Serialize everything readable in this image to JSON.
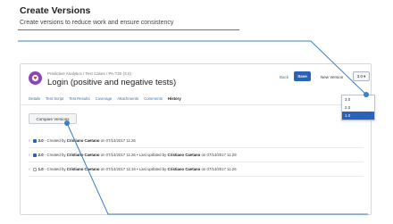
{
  "header": {
    "title": "Create Versions",
    "subtitle": "Create versions to reduce work and ensure consistency"
  },
  "test_case": {
    "breadcrumb": "Predictive Analytics / Test Cases / PA-T20 (3.0)",
    "title": "Login (positive and negative tests)"
  },
  "toolbar": {
    "back_label": "Back",
    "save_label": "Save",
    "new_version_label": "New Version",
    "version_selected": "3.0",
    "version_options": [
      "3.0",
      "2.0",
      "1.0"
    ],
    "highlighted_option": "1.0"
  },
  "tabs": [
    "Details",
    "Test Script",
    "Test Results",
    "Coverage",
    "Attachments",
    "Comments",
    "History"
  ],
  "active_tab": "History",
  "compare_button_label": "Compare Versions",
  "versions": [
    {
      "version": "3.0",
      "created_prefix": "- Created by",
      "created_by": "Cristiano Caetano",
      "created_on": "on 07/14/2017 11:26",
      "updated_text": "",
      "updated_by": "",
      "updated_on": "",
      "checked": true
    },
    {
      "version": "2.0",
      "created_prefix": "- Created by",
      "created_by": "Cristiano Caetano",
      "created_on": "on 07/14/2017 11:26",
      "updated_text": "• Last updated by",
      "updated_by": "Cristiano Caetano",
      "updated_on": "on 07/14/2017 11:28",
      "checked": true
    },
    {
      "version": "1.0",
      "created_prefix": "- Created by",
      "created_by": "Cristiano Caetano",
      "created_on": "on 07/14/2017 11:19",
      "updated_text": "• Last updated by",
      "updated_by": "Cristiano Caetano",
      "updated_on": "on 07/14/2017 11:26",
      "checked": false
    }
  ],
  "colors": {
    "accent": "#2a62b6",
    "callout_line": "#3b7fc4",
    "app_logo": "#8a46b8"
  },
  "icons": {
    "logo": "app-logo-icon",
    "select": "chevron-down-icon",
    "row_expand": "chevron-right-icon"
  }
}
